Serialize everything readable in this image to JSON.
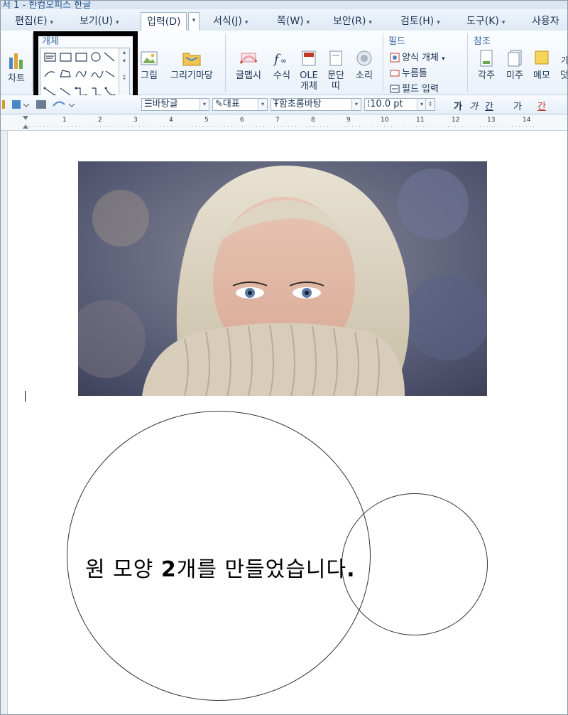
{
  "window": {
    "title": "서 1 - 한컴오피스 한글"
  },
  "menubar": {
    "items": [
      {
        "label": "편집(E)"
      },
      {
        "label": "보기(U)"
      },
      {
        "label": "입력(D)"
      },
      {
        "label": "서식(J)"
      },
      {
        "label": "쪽(W)"
      },
      {
        "label": "보안(R)"
      },
      {
        "label": "검토(H)"
      },
      {
        "label": "도구(K)"
      },
      {
        "label": "사용자"
      }
    ]
  },
  "ribbon": {
    "chart_label": "차트",
    "object_group_label": "개체",
    "picture_label": "그림",
    "drawmaru_label": "그리기마당",
    "glyph_label": "글맵시",
    "equation_label": "수식",
    "ole_label_top": "OLE",
    "ole_label_bottom": "개체",
    "paragraph_label_top": "문단",
    "paragraph_label_bottom": "띠",
    "sound_label": "소리",
    "field_group_label": "필드",
    "field_items": [
      {
        "label": "양식 개체"
      },
      {
        "label": "누름틀"
      },
      {
        "label": "필드 입력"
      }
    ],
    "ref_group_label": "참조",
    "footnote_label": "각주",
    "endnote_label": "미주",
    "memo_label": "메모",
    "more_label": "덧"
  },
  "format_toolbar": {
    "style_value": "바탕글",
    "lang_value": "대표",
    "font_value": "함초롬바탕",
    "size_value": "10.0",
    "size_unit": "pt",
    "bold_label": "가",
    "italic_label": "가",
    "underline_label": "간",
    "strike_label": "가",
    "color_label": "간"
  },
  "ruler": {
    "ticks": [
      "1",
      "2",
      "3",
      "4",
      "5",
      "6",
      "7",
      "8",
      "9",
      "10",
      "11",
      "12",
      "13",
      "14"
    ]
  },
  "document": {
    "text_prefix": "원 모양 ",
    "text_bold": "2",
    "text_suffix": "개를 만들었습니다",
    "text_end": "."
  }
}
